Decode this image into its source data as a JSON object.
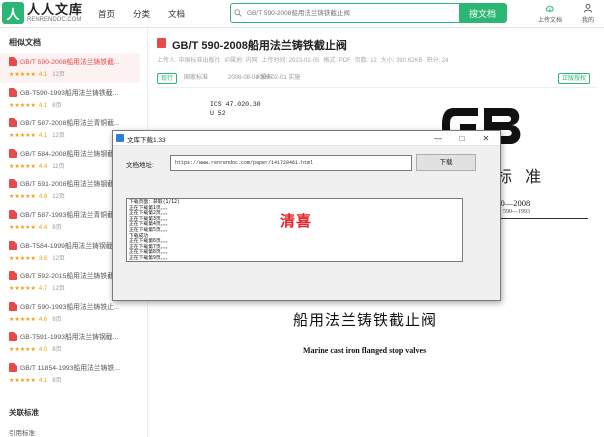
{
  "header": {
    "logo_cn": "人人文库",
    "logo_en": "RENRENDOC.COM",
    "nav": [
      "首页",
      "分类",
      "文档"
    ],
    "search_placeholder": "GB/T 590-2008船用法兰铸铁截止阀",
    "search_button": "搜文档",
    "upload_label": "上传文档",
    "profile_label": "我的"
  },
  "sidebar": {
    "title": "相似文档",
    "items": [
      {
        "title": "GB/T 590-2008船用法兰铸铁截...",
        "score": "4.1",
        "pages": "12页",
        "active": true
      },
      {
        "title": "GB-T590-1993船用法兰铸铁截...",
        "score": "4.1",
        "pages": "8页"
      },
      {
        "title": "GB/T 587-2008船用法兰青铜截...",
        "score": "4.1",
        "pages": "12页"
      },
      {
        "title": "GB/T 584-2008船用法兰铸钢截...",
        "score": "4.4",
        "pages": "11页"
      },
      {
        "title": "GB/T 591-2008船用法兰铸钢截...",
        "score": "4.8",
        "pages": "12页"
      },
      {
        "title": "GB/T 587-1993船用法兰青铜截...",
        "score": "4.4",
        "pages": "8页"
      },
      {
        "title": "GB-T584-1999船用法兰铸钢截...",
        "score": "3.6",
        "pages": "12页"
      },
      {
        "title": "GB/T 592-2015船用法兰铸铁截...",
        "score": "4.7",
        "pages": "12页"
      },
      {
        "title": "GB/T 590-1993船用法兰铸铁止...",
        "score": "4.6",
        "pages": "8页"
      },
      {
        "title": "GB-T591-1993船用法兰铸钢截...",
        "score": "4.0",
        "pages": "8页"
      },
      {
        "title": "GB/T 11854-1993船用法兰铸铁...",
        "score": "4.1",
        "pages": "8页"
      }
    ],
    "related_title": "关联标准",
    "related_line": "引用标准:"
  },
  "document": {
    "title": "GB/T 590-2008船用法兰铸铁截止阀",
    "meta": [
      "上传人: 中国标准出版社",
      "IP属地: 内网",
      "上传时间: 2023-02-05",
      "格式: PDF",
      "页数: 12",
      "大小: 390.62KB",
      "积分: 24"
    ],
    "tags": [
      "现行",
      "国家标准",
      "2008-08-04 颁布",
      "2009-02-01 实施"
    ],
    "correction_label": "正版授权",
    "ics": "ICS 47.020.30",
    "ccs": "U 52",
    "std_word": "标  准",
    "std_no": "590—2008",
    "std_replaces": "590—1993",
    "cn_title": "船用法兰铸铁截止阀",
    "en_title": "Marine cast iron flanged stop valves"
  },
  "dialog": {
    "title": "文库下载1.33",
    "address_label": "文档地址:",
    "address_value": "https://www.renrendoc.com/paper/141728461.html",
    "download_button": "下载",
    "banner": "清喜",
    "log": [
      "下载页面：获取(1/12)",
      "正在下载第1页。。。",
      "正在下载第2页。。。",
      "正在下载第3页。。。",
      "正在下载第4页。。。",
      "正在下载第5页。。。",
      "下载成功",
      "正在下载第6页。。。",
      "正在下载第7页。。。",
      "正在下载第8页。。。",
      "正在下载第9页。。。",
      "下载完成"
    ]
  },
  "colors": {
    "brand": "#2bb673",
    "accent": "#e84a4a",
    "banner": "#e8242a"
  }
}
